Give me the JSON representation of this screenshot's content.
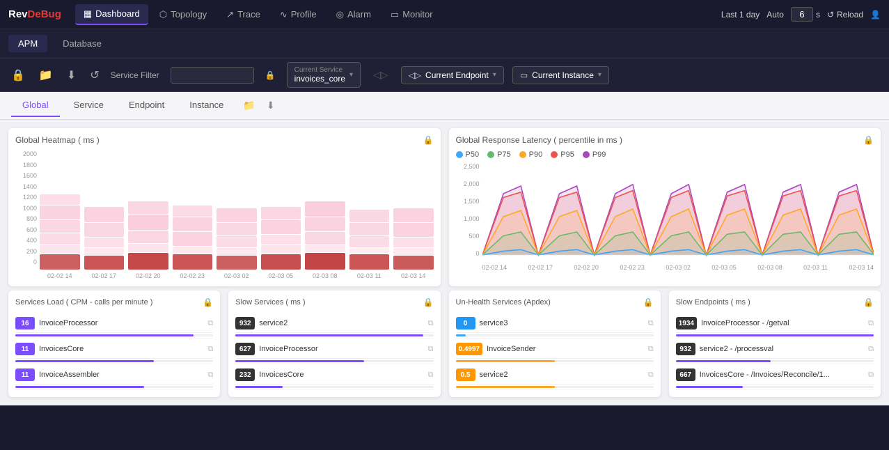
{
  "logo": {
    "rev": "Rev",
    "debug": "DeBug"
  },
  "nav": {
    "items": [
      {
        "id": "dashboard",
        "label": "Dashboard",
        "icon": "▦",
        "active": true
      },
      {
        "id": "topology",
        "label": "Topology",
        "icon": "⬡"
      },
      {
        "id": "trace",
        "label": "Trace",
        "icon": "↗"
      },
      {
        "id": "profile",
        "label": "Profile",
        "icon": "∿"
      },
      {
        "id": "alarm",
        "label": "Alarm",
        "icon": "◎"
      },
      {
        "id": "monitor",
        "label": "Monitor",
        "icon": "▭"
      }
    ]
  },
  "topRight": {
    "timeRange": "Last 1 day",
    "auto": "Auto",
    "interval": "6",
    "intervalUnit": "s",
    "reload": "Reload",
    "userIcon": "👤"
  },
  "secondToolbar": {
    "tabs": [
      {
        "id": "apm",
        "label": "APM",
        "active": true
      },
      {
        "id": "database",
        "label": "Database"
      }
    ]
  },
  "filterBar": {
    "serviceFilterLabel": "Service Filter",
    "serviceFilterPlaceholder": "",
    "currentServiceLabel": "Current Service",
    "currentServiceValue": "invoices_core",
    "currentEndpointLabel": "Current Endpoint",
    "currentInstanceLabel": "Current Instance"
  },
  "pageTabs": {
    "tabs": [
      {
        "id": "global",
        "label": "Global",
        "active": true
      },
      {
        "id": "service",
        "label": "Service"
      },
      {
        "id": "endpoint",
        "label": "Endpoint"
      },
      {
        "id": "instance",
        "label": "Instance"
      }
    ]
  },
  "heatmap": {
    "title": "Global Heatmap ( ms )",
    "yLabels": [
      "2000",
      "1800",
      "1600",
      "1400",
      "1200",
      "1000",
      "800",
      "600",
      "400",
      "200",
      "0"
    ],
    "xLabels": [
      "02-02 14",
      "02-02 17",
      "02-02 20",
      "02-02 23",
      "02-03 02",
      "02-03 05",
      "02-03 08",
      "02-03 11",
      "02-03 14"
    ],
    "columns": [
      {
        "blocks": [
          8,
          20,
          18,
          16,
          12,
          10,
          8,
          40
        ]
      },
      {
        "blocks": [
          12,
          22,
          20,
          14,
          10,
          8,
          6,
          38
        ]
      },
      {
        "blocks": [
          10,
          18,
          22,
          18,
          14,
          8,
          10,
          42
        ]
      },
      {
        "blocks": [
          8,
          16,
          20,
          20,
          12,
          10,
          8,
          40
        ]
      },
      {
        "blocks": [
          10,
          20,
          18,
          16,
          10,
          8,
          8,
          38
        ]
      },
      {
        "blocks": [
          8,
          18,
          20,
          14,
          12,
          8,
          10,
          40
        ]
      },
      {
        "blocks": [
          10,
          22,
          20,
          18,
          10,
          8,
          8,
          42
        ]
      },
      {
        "blocks": [
          8,
          18,
          18,
          16,
          12,
          8,
          8,
          40
        ]
      },
      {
        "blocks": [
          10,
          20,
          20,
          14,
          10,
          8,
          8,
          38
        ]
      }
    ]
  },
  "latencyChart": {
    "title": "Global Response Latency ( percentile in ms )",
    "legend": [
      {
        "id": "p50",
        "label": "P50",
        "color": "#42a5f5"
      },
      {
        "id": "p75",
        "label": "P75",
        "color": "#66bb6a"
      },
      {
        "id": "p90",
        "label": "P90",
        "color": "#ffa726"
      },
      {
        "id": "p95",
        "label": "P95",
        "color": "#ef5350"
      },
      {
        "id": "p99",
        "label": "P99",
        "color": "#ab47bc"
      }
    ],
    "yLabels": [
      "2,500",
      "2,000",
      "1,500",
      "1,000",
      "500",
      "0"
    ],
    "xLabels": [
      "02-02 14",
      "02-02 17",
      "02-02 20",
      "02-02 23",
      "02-03 02",
      "02-03 05",
      "02-03 08",
      "02-03 11",
      "02-03 14"
    ]
  },
  "servicesLoad": {
    "title": "Services Load ( CPM - calls per minute )",
    "items": [
      {
        "badge": "16",
        "badgeColor": "purple",
        "name": "InvoiceProcessor",
        "barColor": "#7c4dff",
        "barWidth": "90%"
      },
      {
        "badge": "11",
        "badgeColor": "purple",
        "name": "InvoicesCore",
        "barColor": "#7c4dff",
        "barWidth": "70%"
      },
      {
        "badge": "11",
        "badgeColor": "purple",
        "name": "InvoiceAssembler",
        "barColor": "#7c4dff",
        "barWidth": "65%"
      }
    ]
  },
  "slowServices": {
    "title": "Slow Services ( ms )",
    "items": [
      {
        "badge": "932",
        "badgeColor": "dark",
        "name": "service2",
        "barColor": "#7c4dff",
        "barWidth": "95%"
      },
      {
        "badge": "627",
        "badgeColor": "dark",
        "name": "InvoiceProcessor",
        "barColor": "#7c4dff",
        "barWidth": "65%"
      },
      {
        "badge": "232",
        "badgeColor": "dark",
        "name": "InvoicesCore",
        "barColor": "#7c4dff",
        "barWidth": "24%"
      }
    ]
  },
  "unHealthServices": {
    "title": "Un-Health Services (Apdex)",
    "items": [
      {
        "badge": "0",
        "badgeColor": "blue",
        "name": "service3",
        "barColor": "#42a5f5",
        "barWidth": "5%"
      },
      {
        "badge": "0.4997",
        "badgeColor": "orange",
        "name": "InvoiceSender",
        "barColor": "#ffa726",
        "barWidth": "50%"
      },
      {
        "badge": "0.5",
        "badgeColor": "orange",
        "name": "service2",
        "barColor": "#ffa726",
        "barWidth": "50%"
      }
    ]
  },
  "slowEndpoints": {
    "title": "Slow Endpoints ( ms )",
    "items": [
      {
        "badge": "1934",
        "badgeColor": "dark",
        "name": "InvoiceProcessor - /getval",
        "barColor": "#7c4dff",
        "barWidth": "100%"
      },
      {
        "badge": "932",
        "badgeColor": "dark",
        "name": "service2 - /processval",
        "barColor": "#7c4dff",
        "barWidth": "48%"
      },
      {
        "badge": "667",
        "badgeColor": "dark",
        "name": "InvoicesCore - /Invoices/Reconcile/1...",
        "barColor": "#7c4dff",
        "barWidth": "34%"
      }
    ]
  }
}
